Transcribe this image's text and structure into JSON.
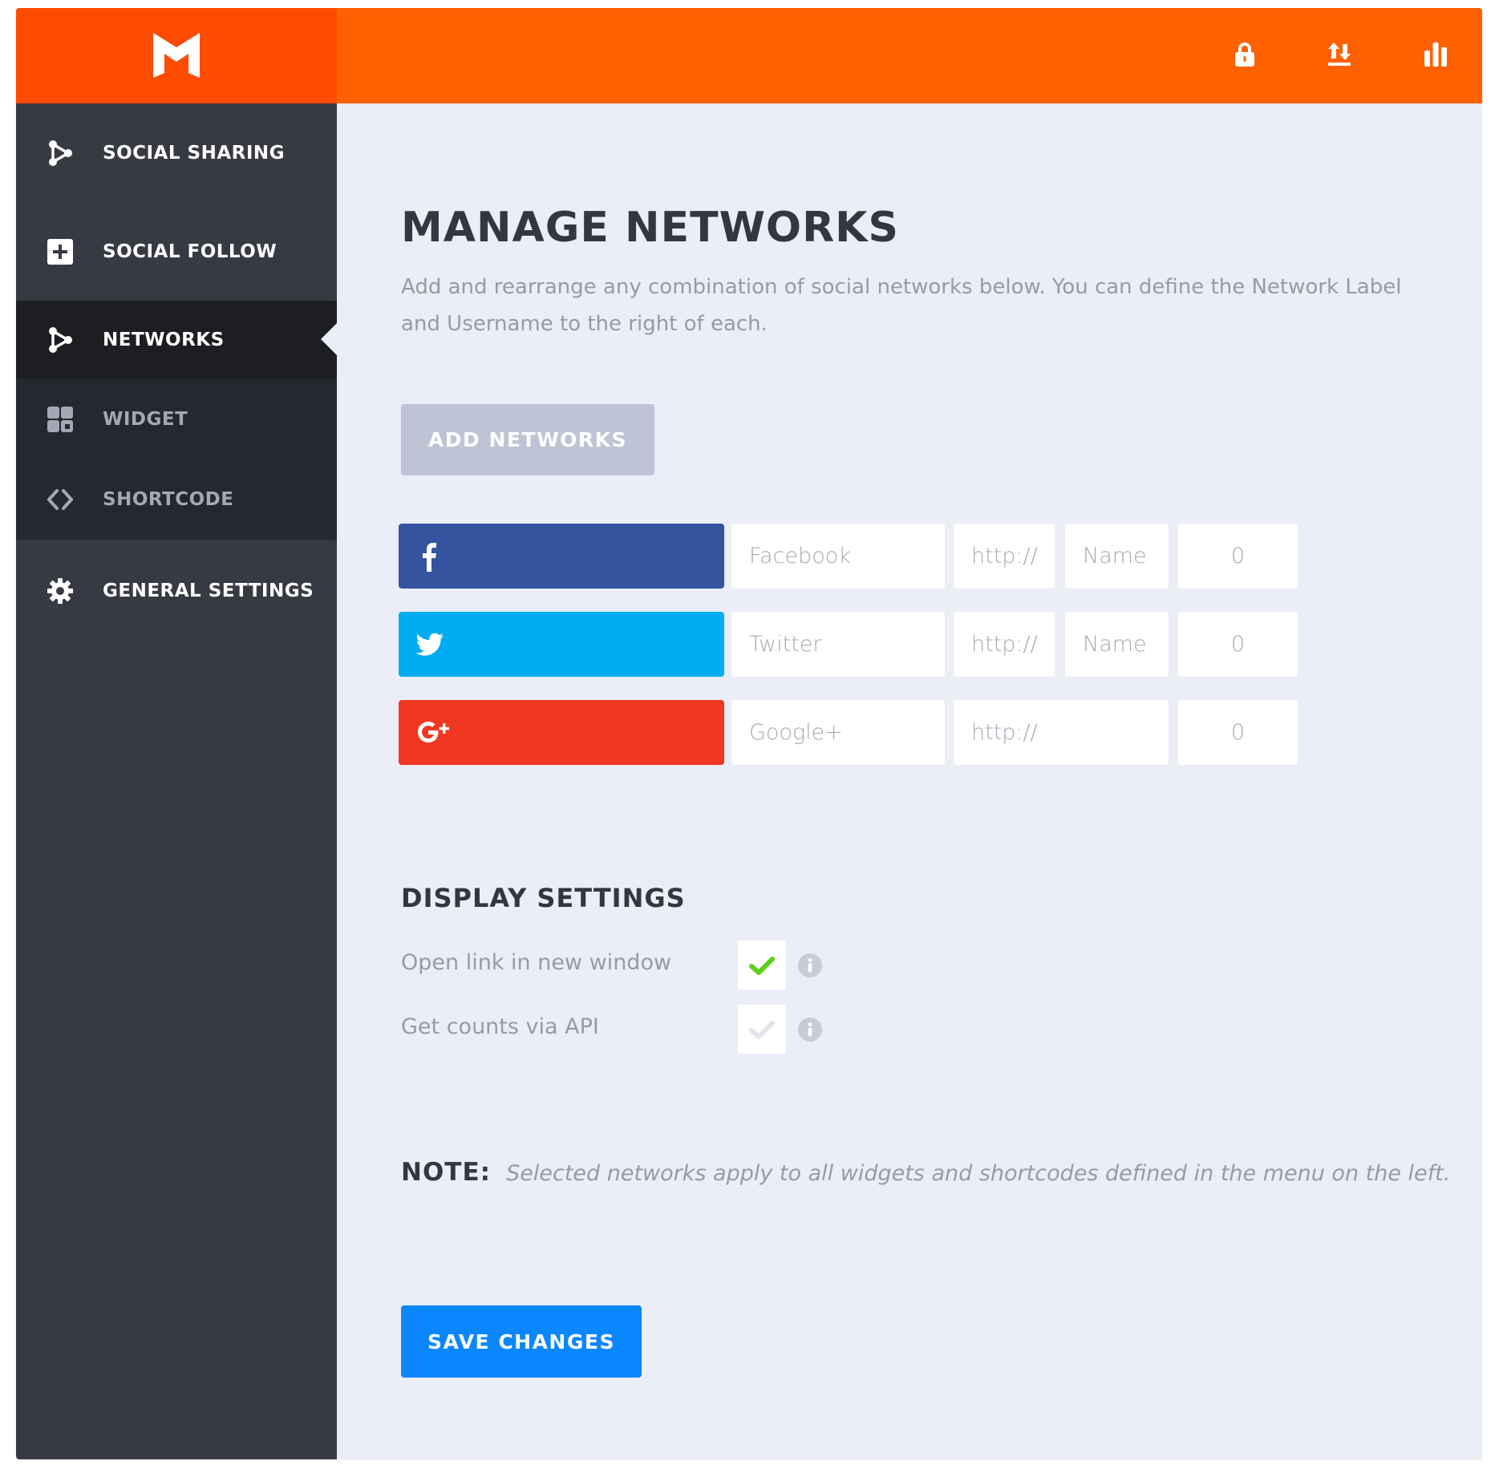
{
  "header": {
    "logo": "M",
    "icons": [
      "lock-icon",
      "import-export-icon",
      "stats-icon"
    ],
    "colors": {
      "logo_bg": "#ff4b00",
      "bar_bg": "#ff6000"
    }
  },
  "sidebar": {
    "items": [
      {
        "label": "SOCIAL SHARING",
        "icon": "share-nodes-icon",
        "active": false
      },
      {
        "label": "SOCIAL FOLLOW",
        "icon": "plus-square-icon",
        "active": false
      },
      {
        "label": "NETWORKS",
        "icon": "share-nodes-icon",
        "active": true
      },
      {
        "label": "WIDGET",
        "icon": "widget-grid-icon",
        "active": false,
        "submenu": true
      },
      {
        "label": "SHORTCODE",
        "icon": "code-brackets-icon",
        "active": false,
        "submenu": true
      },
      {
        "label": "GENERAL SETTINGS",
        "icon": "gear-icon",
        "active": false
      }
    ]
  },
  "main": {
    "title": "MANAGE NETWORKS",
    "description": "Add and rearrange any combination of social networks below. You can define the Network Label and Username to the right of each.",
    "add_networks_label": "ADD NETWORKS",
    "networks": [
      {
        "name": "facebook",
        "icon": "facebook-icon",
        "color": "#3653a0",
        "label_placeholder": "Facebook",
        "url_placeholder": "http://",
        "username_placeholder": "Name",
        "count": "0"
      },
      {
        "name": "twitter",
        "icon": "twitter-icon",
        "color": "#00acf2",
        "label_placeholder": "Twitter",
        "url_placeholder": "http://",
        "username_placeholder": "Name",
        "count": "0"
      },
      {
        "name": "google-plus",
        "icon": "google-plus-icon",
        "color": "#f03720",
        "label_placeholder": "Google+",
        "url_placeholder": "http://",
        "count": "0"
      }
    ],
    "display_settings": {
      "title": "DISPLAY SETTINGS",
      "options": [
        {
          "label": "Open link in new window",
          "checked": true
        },
        {
          "label": "Get counts via API",
          "checked": false
        }
      ]
    },
    "note": {
      "label": "NOTE:",
      "text": "Selected networks apply to all widgets and shortcodes defined in the menu on the left."
    },
    "save_label": "SAVE CHANGES",
    "colors": {
      "save": "#0a87fe",
      "add": "#bec4d6",
      "check": "#5fcf19"
    }
  }
}
